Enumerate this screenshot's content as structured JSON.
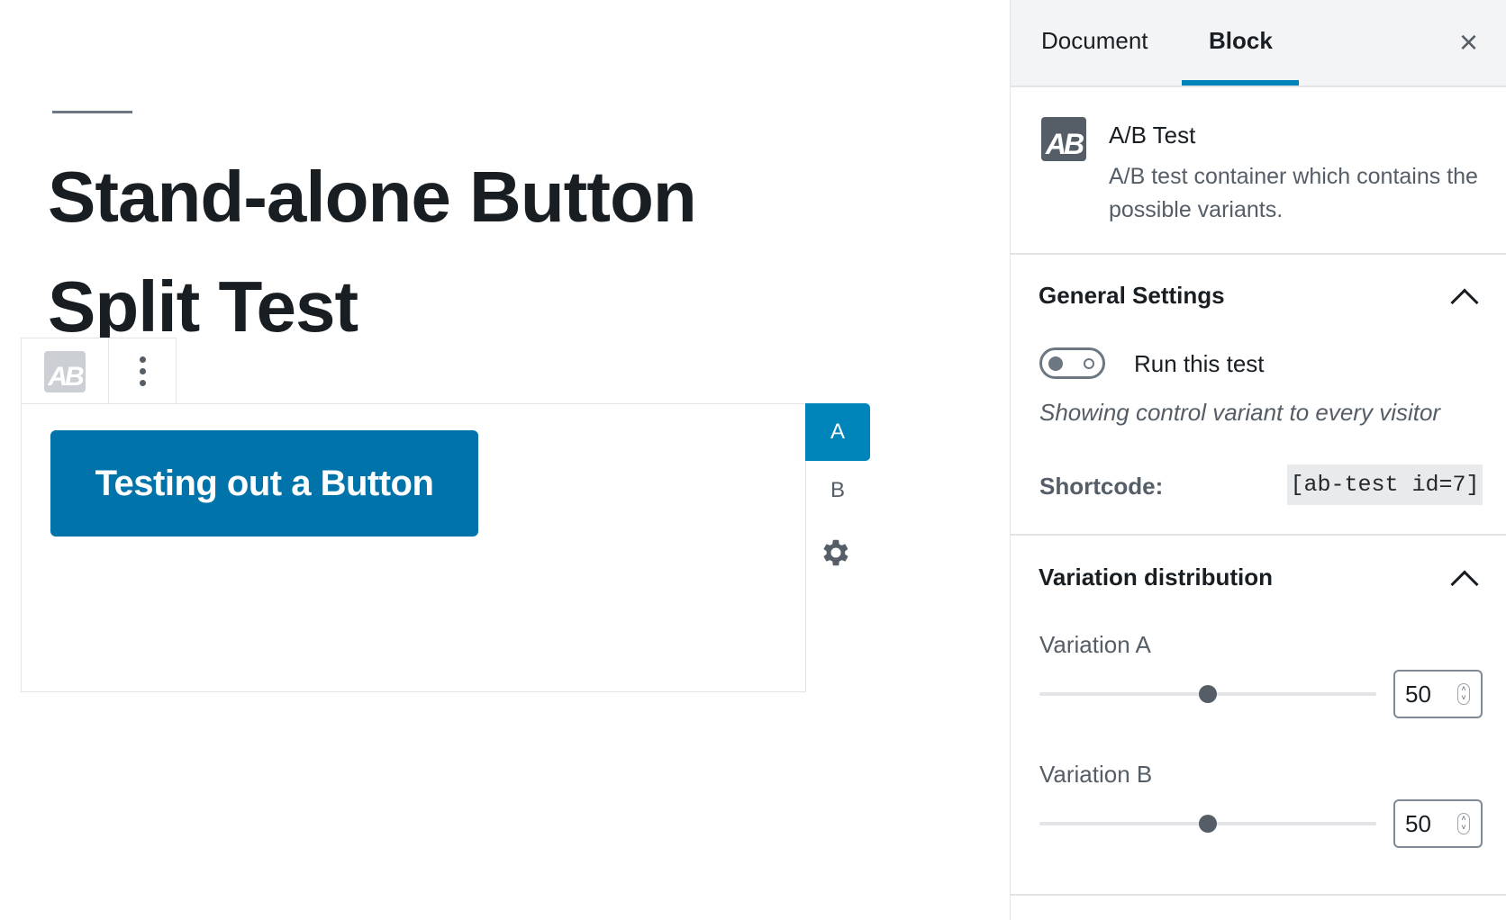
{
  "editor": {
    "title": "Stand-alone Button Split Test",
    "toolbar": {
      "block_icon": "AB",
      "more_icon": "more-vertical-icon"
    },
    "button_label": "Testing out a Button",
    "variant_tabs": [
      "A",
      "B"
    ],
    "settings_icon": "gear-icon"
  },
  "sidebar": {
    "tabs": [
      "Document",
      "Block"
    ],
    "active_tab": "Block",
    "close_icon": "×",
    "block_card": {
      "icon": "AB",
      "title": "A/B Test",
      "description": "A/B test container which contains the possible variants."
    },
    "general_settings": {
      "title": "General Settings",
      "toggle_label": "Run this test",
      "toggle_on": false,
      "status": "Showing control variant to every visitor",
      "shortcode_label": "Shortcode:",
      "shortcode": "[ab-test id=7]"
    },
    "variation_distribution": {
      "title": "Variation distribution",
      "variations": [
        {
          "label": "Variation A",
          "value": "50",
          "percent": 50
        },
        {
          "label": "Variation B",
          "value": "50",
          "percent": 50
        }
      ]
    }
  },
  "colors": {
    "accent": "#0085ba",
    "button": "#0073aa"
  }
}
